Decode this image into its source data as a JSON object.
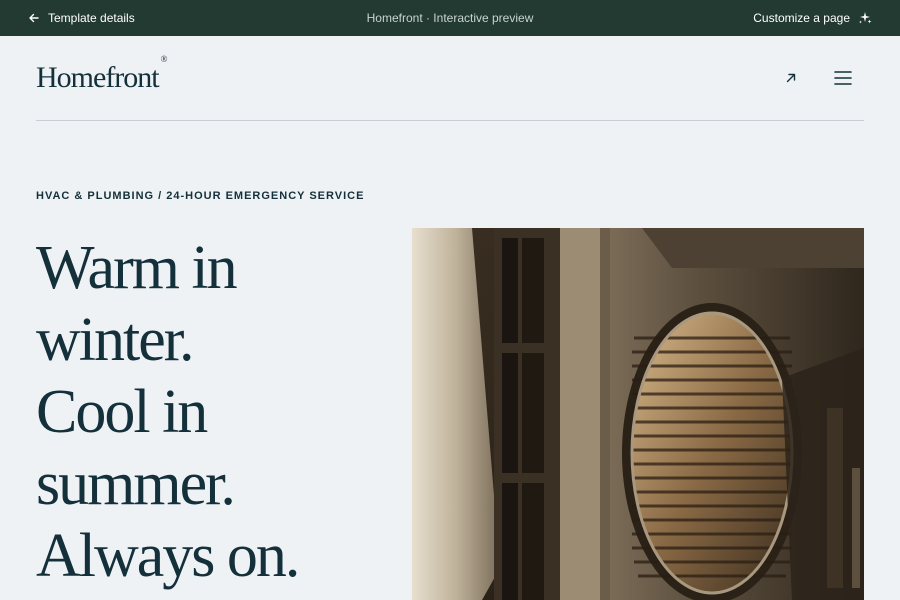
{
  "topbar": {
    "back_label": "Template details",
    "center_title": "Homefront · Interactive preview",
    "customize_label": "Customize a page",
    "icons": {
      "back": "arrow-left-icon",
      "customize": "sparkle-icon"
    }
  },
  "header": {
    "brand": "Homefront",
    "brand_mark": "®",
    "icons": {
      "external": "arrow-up-right-icon",
      "menu": "hamburger-menu-icon"
    }
  },
  "hero": {
    "eyebrow": "HVAC & PLUMBING / 24-HOUR EMERGENCY SERVICE",
    "headline_lines": [
      "Warm in",
      "winter.",
      "Cool in",
      "summer.",
      "Always on."
    ]
  },
  "colors": {
    "topbar_bg": "#223a31",
    "page_bg": "#eef2f5",
    "text": "#14303a"
  }
}
